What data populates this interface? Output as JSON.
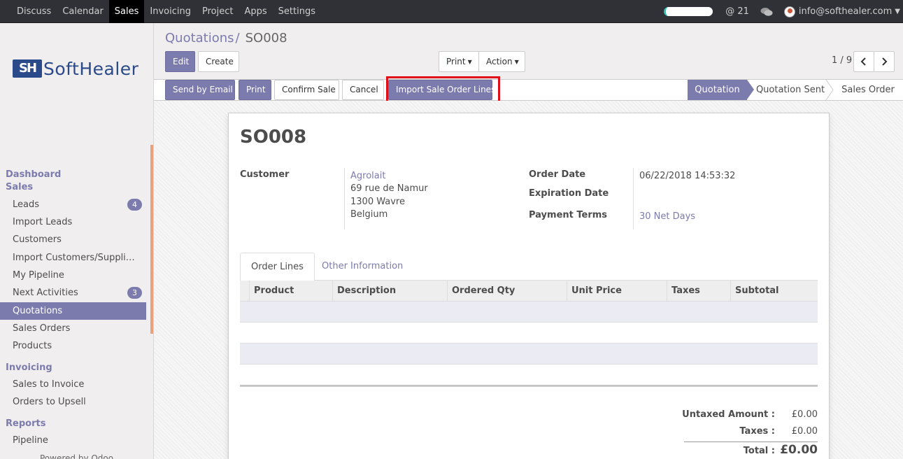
{
  "topbar": {
    "menu": [
      "Discuss",
      "Calendar",
      "Sales",
      "Invoicing",
      "Project",
      "Apps",
      "Settings"
    ],
    "active": "Sales",
    "mentions": "@ 21",
    "user_email": "info@softhealer.com"
  },
  "logo": {
    "mark": "SH",
    "text": "SoftHealer"
  },
  "sidebar": {
    "sections": {
      "dashboard": "Dashboard",
      "sales": "Sales",
      "invoicing": "Invoicing",
      "reports": "Reports"
    },
    "sales_items": [
      {
        "label": "Leads",
        "badge": "4"
      },
      {
        "label": "Import Leads",
        "badge": ""
      },
      {
        "label": "Customers",
        "badge": ""
      },
      {
        "label": "Import Customers/Suppli…",
        "badge": ""
      },
      {
        "label": "My Pipeline",
        "badge": ""
      },
      {
        "label": "Next Activities",
        "badge": "3"
      },
      {
        "label": "Quotations",
        "badge": ""
      },
      {
        "label": "Sales Orders",
        "badge": ""
      },
      {
        "label": "Products",
        "badge": ""
      }
    ],
    "invoicing_items": [
      "Sales to Invoice",
      "Orders to Upsell"
    ],
    "reports_items": [
      "Pipeline"
    ],
    "powered_by": "Powered by Odoo"
  },
  "breadcrumb": {
    "parent": "Quotations",
    "separator": "/",
    "current": "SO008"
  },
  "control": {
    "edit": "Edit",
    "create": "Create",
    "print": "Print",
    "action": "Action",
    "pager": "1 / 9"
  },
  "statusbar": {
    "buttons": {
      "send_email": "Send by Email",
      "print": "Print",
      "confirm": "Confirm Sale",
      "cancel": "Cancel",
      "import_lines": "Import Sale Order Lines"
    },
    "stages": [
      "Quotation",
      "Quotation Sent",
      "Sales Order"
    ],
    "active_stage": "Quotation"
  },
  "form": {
    "name": "SO008",
    "customer_label": "Customer",
    "customer_name": "Agrolait",
    "address": [
      "69 rue de Namur",
      "1300 Wavre",
      "Belgium"
    ],
    "order_date_label": "Order Date",
    "order_date": "06/22/2018 14:53:32",
    "expiration_label": "Expiration Date",
    "payment_terms_label": "Payment Terms",
    "payment_terms": "30 Net Days",
    "tabs": [
      "Order Lines",
      "Other Information"
    ],
    "columns": [
      "Product",
      "Description",
      "Ordered Qty",
      "Unit Price",
      "Taxes",
      "Subtotal"
    ],
    "totals": {
      "untaxed_label": "Untaxed Amount :",
      "untaxed": "£0.00",
      "taxes_label": "Taxes :",
      "taxes": "£0.00",
      "total_label": "Total :",
      "total": "£0.00"
    }
  },
  "colors": {
    "accent": "#7c7bad",
    "topbar": "#2f3136",
    "highlight": "#e0101a"
  }
}
